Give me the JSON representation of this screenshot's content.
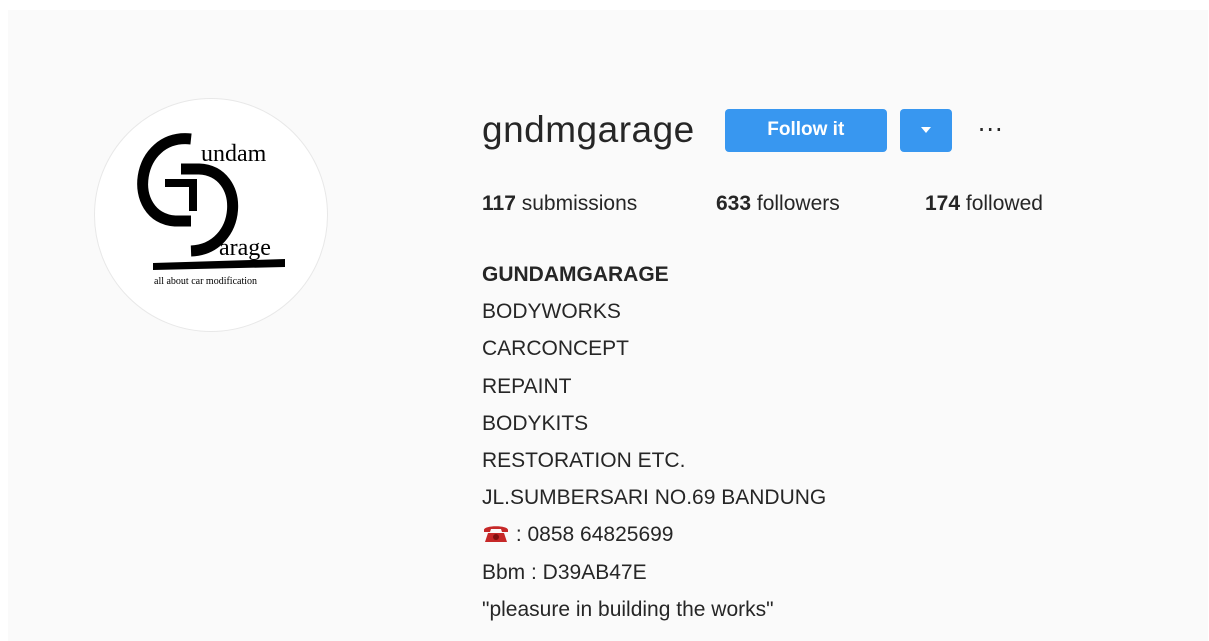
{
  "profile": {
    "username": "gndmgarage",
    "avatar_icon": "gundam-garage-logo",
    "logo_text": {
      "top": "undam",
      "bottom": "arage",
      "tagline": "all about car modification"
    }
  },
  "actions": {
    "follow_label": "Follow it",
    "dropdown_icon": "caret-down-icon",
    "more_label": "···"
  },
  "stats": [
    {
      "count": "117",
      "label": " submissions"
    },
    {
      "count": "633",
      "label": " followers"
    },
    {
      "count": "174",
      "label": " followed"
    }
  ],
  "bio": {
    "full_name": "GUNDAMGARAGE",
    "lines": [
      "BODYWORKS",
      "CARCONCEPT",
      "REPAINT",
      "BODYKITS",
      "RESTORATION ETC.",
      "JL.SUMBERSARI NO.69 BANDUNG"
    ],
    "phone_icon": "telephone-icon",
    "phone": " : 0858 64825699",
    "bbm": "Bbm : D39AB47E",
    "motto": "\"pleasure in building the works\""
  },
  "colors": {
    "accent": "#3897f0",
    "text": "#262626",
    "background": "#fafafa",
    "phone_icon": "#c62828"
  }
}
